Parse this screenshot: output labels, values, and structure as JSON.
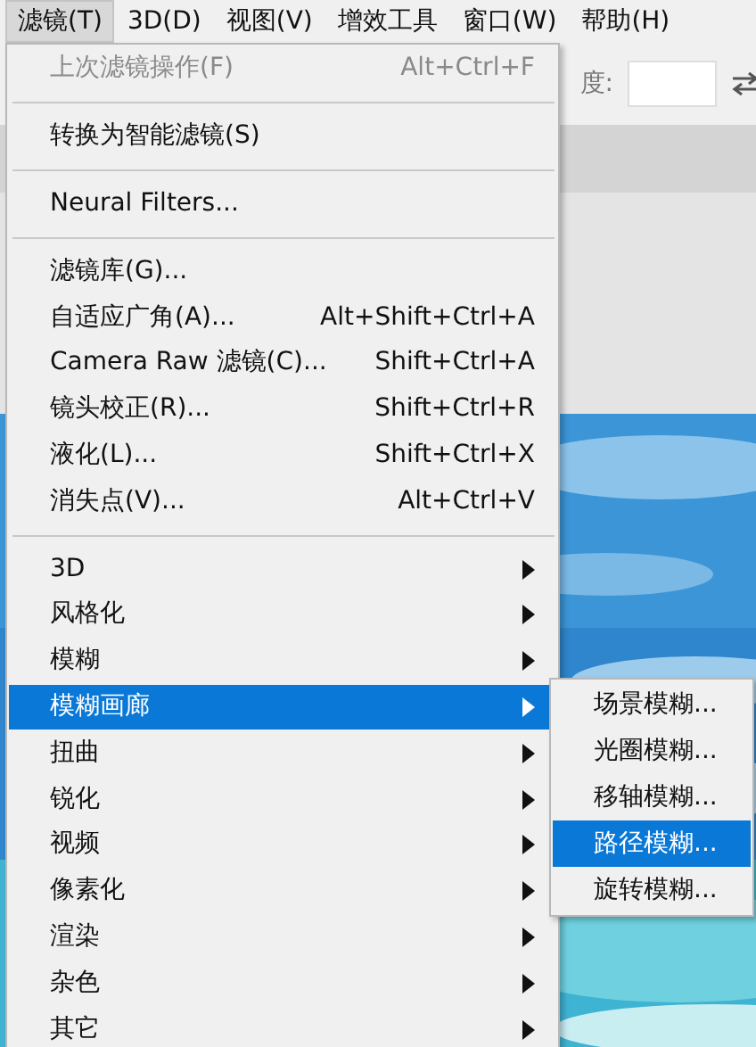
{
  "menubar": [
    {
      "label": "滤镜(T)",
      "selected": true
    },
    {
      "label": "3D(D)",
      "selected": false
    },
    {
      "label": "视图(V)",
      "selected": false
    },
    {
      "label": "增效工具",
      "selected": false
    },
    {
      "label": "窗口(W)",
      "selected": false
    },
    {
      "label": "帮助(H)",
      "selected": false
    }
  ],
  "options_bar": {
    "label": "度:"
  },
  "menu": {
    "groups": [
      [
        {
          "label": "上次滤镜操作(F)",
          "shortcut": "Alt+Ctrl+F",
          "kind": "item",
          "disabled": true,
          "selected": false
        }
      ],
      [
        {
          "label": "转换为智能滤镜(S)",
          "kind": "item",
          "disabled": false,
          "selected": false
        }
      ],
      [
        {
          "label": "Neural Filters...",
          "kind": "item",
          "disabled": false,
          "selected": false
        }
      ],
      [
        {
          "label": "滤镜库(G)...",
          "kind": "item",
          "disabled": false,
          "selected": false
        },
        {
          "label": "自适应广角(A)...",
          "shortcut": "Alt+Shift+Ctrl+A",
          "kind": "item",
          "disabled": false,
          "selected": false
        },
        {
          "label": "Camera Raw 滤镜(C)...",
          "shortcut": "Shift+Ctrl+A",
          "kind": "item",
          "disabled": false,
          "selected": false
        },
        {
          "label": "镜头校正(R)...",
          "shortcut": "Shift+Ctrl+R",
          "kind": "item",
          "disabled": false,
          "selected": false
        },
        {
          "label": "液化(L)...",
          "shortcut": "Shift+Ctrl+X",
          "kind": "item",
          "disabled": false,
          "selected": false
        },
        {
          "label": "消失点(V)...",
          "shortcut": "Alt+Ctrl+V",
          "kind": "item",
          "disabled": false,
          "selected": false
        }
      ],
      [
        {
          "label": "3D",
          "kind": "submenu",
          "disabled": false,
          "selected": false
        },
        {
          "label": "风格化",
          "kind": "submenu",
          "disabled": false,
          "selected": false
        },
        {
          "label": "模糊",
          "kind": "submenu",
          "disabled": false,
          "selected": false
        },
        {
          "label": "模糊画廊",
          "kind": "submenu",
          "disabled": false,
          "selected": true
        },
        {
          "label": "扭曲",
          "kind": "submenu",
          "disabled": false,
          "selected": false
        },
        {
          "label": "锐化",
          "kind": "submenu",
          "disabled": false,
          "selected": false
        },
        {
          "label": "视频",
          "kind": "submenu",
          "disabled": false,
          "selected": false
        },
        {
          "label": "像素化",
          "kind": "submenu",
          "disabled": false,
          "selected": false
        },
        {
          "label": "渲染",
          "kind": "submenu",
          "disabled": false,
          "selected": false
        },
        {
          "label": "杂色",
          "kind": "submenu",
          "disabled": false,
          "selected": false
        },
        {
          "label": "其它",
          "kind": "submenu",
          "disabled": false,
          "selected": false
        }
      ]
    ]
  },
  "submenu": {
    "items": [
      {
        "label": "场景模糊...",
        "selected": false
      },
      {
        "label": "光圈模糊...",
        "selected": false
      },
      {
        "label": "移轴模糊...",
        "selected": false
      },
      {
        "label": "路径模糊...",
        "selected": true
      },
      {
        "label": "旋转模糊...",
        "selected": false
      }
    ]
  }
}
